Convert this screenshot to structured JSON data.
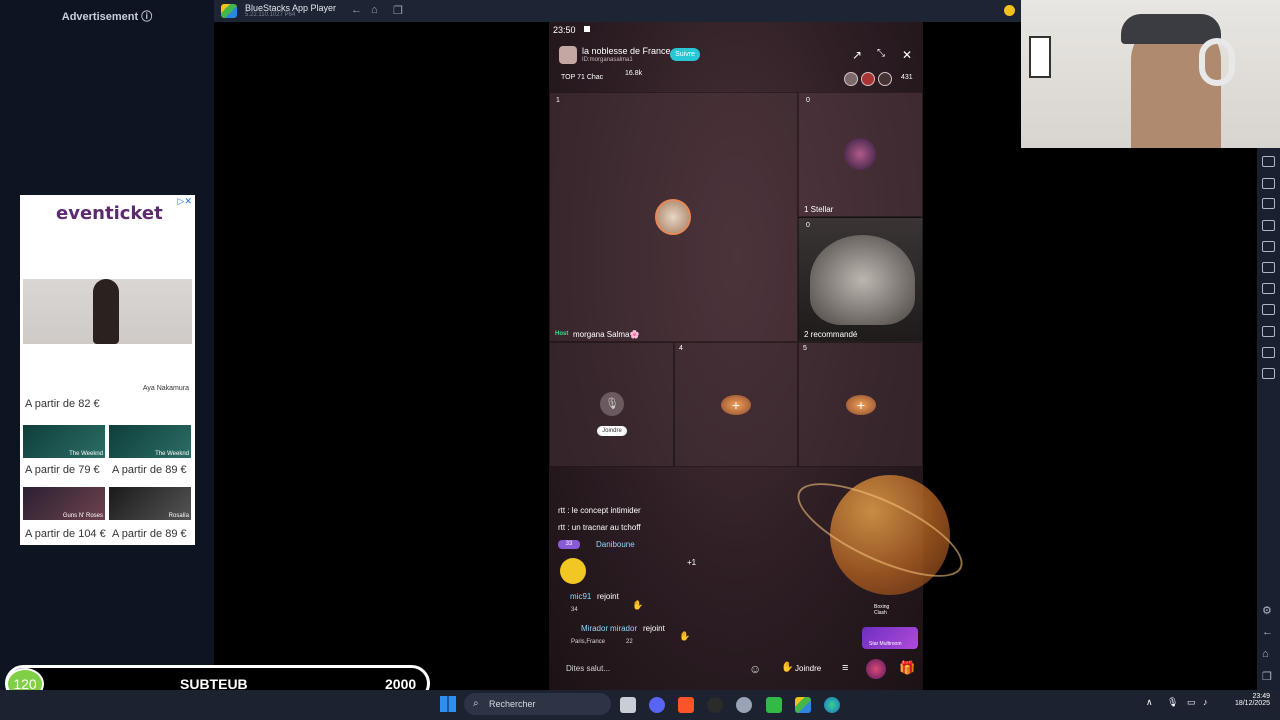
{
  "ad": {
    "label": "Advertisement ⓘ",
    "brand": "eventicket",
    "hero_caption": "Aya Nakamura",
    "hero_price": "A partir de 82 €",
    "items": [
      {
        "label": "The Weeknd",
        "price": "A partir de 79 €"
      },
      {
        "label": "The Weeknd",
        "price": "A partir de 89 €"
      },
      {
        "label": "Guns N' Roses",
        "price": "A partir de 104 €"
      },
      {
        "label": "Rosalía",
        "price": "A partir de 89 €"
      }
    ]
  },
  "score": {
    "count": "120",
    "name": "SUBTEUB",
    "goal": "2000",
    "progress_fraction": 0.06
  },
  "bluestacks": {
    "title": "BlueStacks App Player",
    "version": "5.22.110.1027 P64"
  },
  "phone": {
    "status_time": "23:50",
    "room_name": "la noblesse de France",
    "room_id": "ID:morganasalma1",
    "follow_label": "Suivre",
    "top_rank": "TOP 71 Chac",
    "coins": "16.8k",
    "viewers": "431",
    "seats": [
      {
        "count": "1",
        "tag": "Host",
        "label": "morgana Salma🌸"
      },
      {
        "count": "0",
        "label": "1   Stellar"
      },
      {
        "count": "0",
        "label": "2   recommandé"
      },
      {
        "join_label": "Joindre"
      },
      {
        "index": "4"
      },
      {
        "index": "5"
      }
    ],
    "chat": [
      {
        "text": "rtt : le concept intimider"
      },
      {
        "text": "rtt : un tracnar au tchoff"
      },
      {
        "badge": "33",
        "user": "Daniboune"
      },
      {
        "user": "mic91",
        "action": "rejoint",
        "level": "34"
      },
      {
        "user": "Mirador",
        "action": "rejoint",
        "location": "Paris,France",
        "level": "22"
      }
    ],
    "plus_one": "+1",
    "say_placeholder": "Dites salut...",
    "join_bottom": "Joindre",
    "boxing_label": "Boxing Clash",
    "multiroom_label": "Star Multiroom"
  },
  "taskbar": {
    "search": "Rechercher",
    "time": "23:49",
    "date": "18/12/2025"
  }
}
